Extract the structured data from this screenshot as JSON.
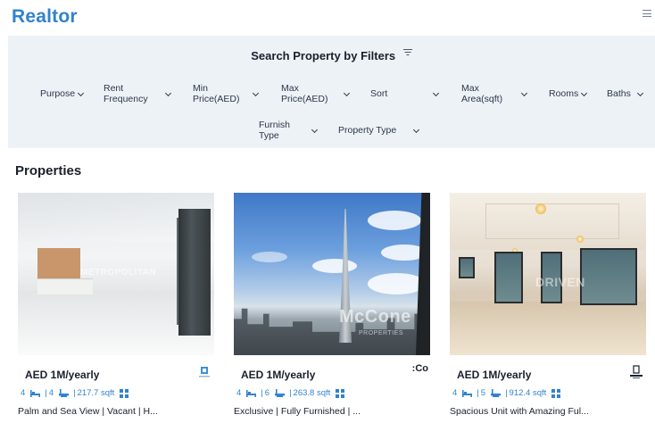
{
  "app": {
    "brand": "Realtor",
    "menu_icon": "hamburger-icon"
  },
  "filters": {
    "title": "Search Property by Filters",
    "title_icon": "filter-icon",
    "selects": [
      {
        "name": "purpose",
        "label": "Purpose"
      },
      {
        "name": "rent-frequency",
        "label": "Rent Frequency"
      },
      {
        "name": "min-price",
        "label": "Min Price(AED)"
      },
      {
        "name": "max-price",
        "label": "Max Price(AED)"
      },
      {
        "name": "sort",
        "label": "Sort"
      },
      {
        "name": "max-area",
        "label": "Max Area(sqft)"
      },
      {
        "name": "rooms",
        "label": "Rooms"
      },
      {
        "name": "baths",
        "label": "Baths"
      },
      {
        "name": "furnish-type",
        "label": "Furnish Type"
      },
      {
        "name": "property-type",
        "label": "Property Type"
      }
    ]
  },
  "properties": {
    "heading": "Properties",
    "cards": [
      {
        "price": "AED 1M/yearly",
        "rooms": "4",
        "baths": "4",
        "area": "217.7 sqft",
        "title": "Palm and Sea View | Vacant | H...",
        "watermark": "METROPOLITAN",
        "agency_icon": "agency-logo-icon"
      },
      {
        "price": "AED 1M/yearly",
        "rooms": "4",
        "baths": "6",
        "area": "263.8 sqft",
        "title": "Exclusive | Fully Furnished | ...",
        "watermark": "McCone",
        "watermark_sub": "PROPERTIES",
        "agency_mark": ":Co",
        "agency_icon": "agency-logo-icon"
      },
      {
        "price": "AED 1M/yearly",
        "rooms": "4",
        "baths": "5",
        "area": "912.4 sqft",
        "title": "Spacious Unit with Amazing Ful...",
        "watermark": "DRIVEN",
        "agency_icon": "agency-logo-icon"
      }
    ]
  },
  "colors": {
    "brand": "#3182ce",
    "filter_bg": "#edf2f7",
    "text": "#1a202c"
  }
}
